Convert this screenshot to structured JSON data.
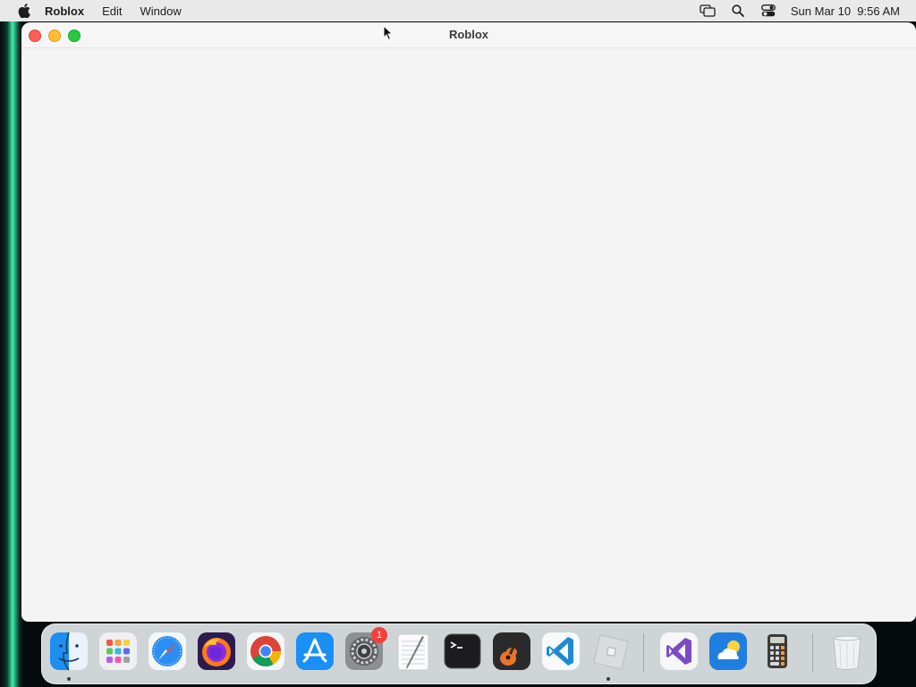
{
  "menubar": {
    "app_name": "Roblox",
    "items": [
      "Edit",
      "Window"
    ],
    "datetime": "Sun Mar 10  9:56 AM",
    "icons": [
      "screen-mirroring-icon",
      "spotlight-search-icon",
      "control-center-icon"
    ]
  },
  "window": {
    "title": "Roblox"
  },
  "dock": {
    "apps": [
      {
        "name": "Finder",
        "icon": "finder-icon",
        "running": true
      },
      {
        "name": "Launchpad",
        "icon": "launchpad-icon",
        "running": false
      },
      {
        "name": "Safari",
        "icon": "safari-icon",
        "running": false
      },
      {
        "name": "Firefox",
        "icon": "firefox-icon",
        "running": false
      },
      {
        "name": "Google Chrome",
        "icon": "chrome-icon",
        "running": false
      },
      {
        "name": "App Store",
        "icon": "app-store-icon",
        "running": false
      },
      {
        "name": "System Settings",
        "icon": "system-settings-icon",
        "running": false,
        "badge": "1"
      },
      {
        "name": "TextEdit",
        "icon": "textedit-icon",
        "running": false
      },
      {
        "name": "Terminal",
        "icon": "terminal-icon",
        "running": false
      },
      {
        "name": "GarageBand",
        "icon": "garageband-icon",
        "running": false
      },
      {
        "name": "Visual Studio Code",
        "icon": "vscode-icon",
        "running": false
      },
      {
        "name": "Roblox",
        "icon": "roblox-icon",
        "running": true
      },
      {
        "name": "Visual Studio",
        "icon": "visual-studio-icon",
        "running": false
      },
      {
        "name": "Weather",
        "icon": "weather-icon",
        "running": false
      },
      {
        "name": "Calculator",
        "icon": "calculator-icon",
        "running": false
      },
      {
        "name": "Trash",
        "icon": "trash-icon",
        "running": false
      }
    ]
  }
}
